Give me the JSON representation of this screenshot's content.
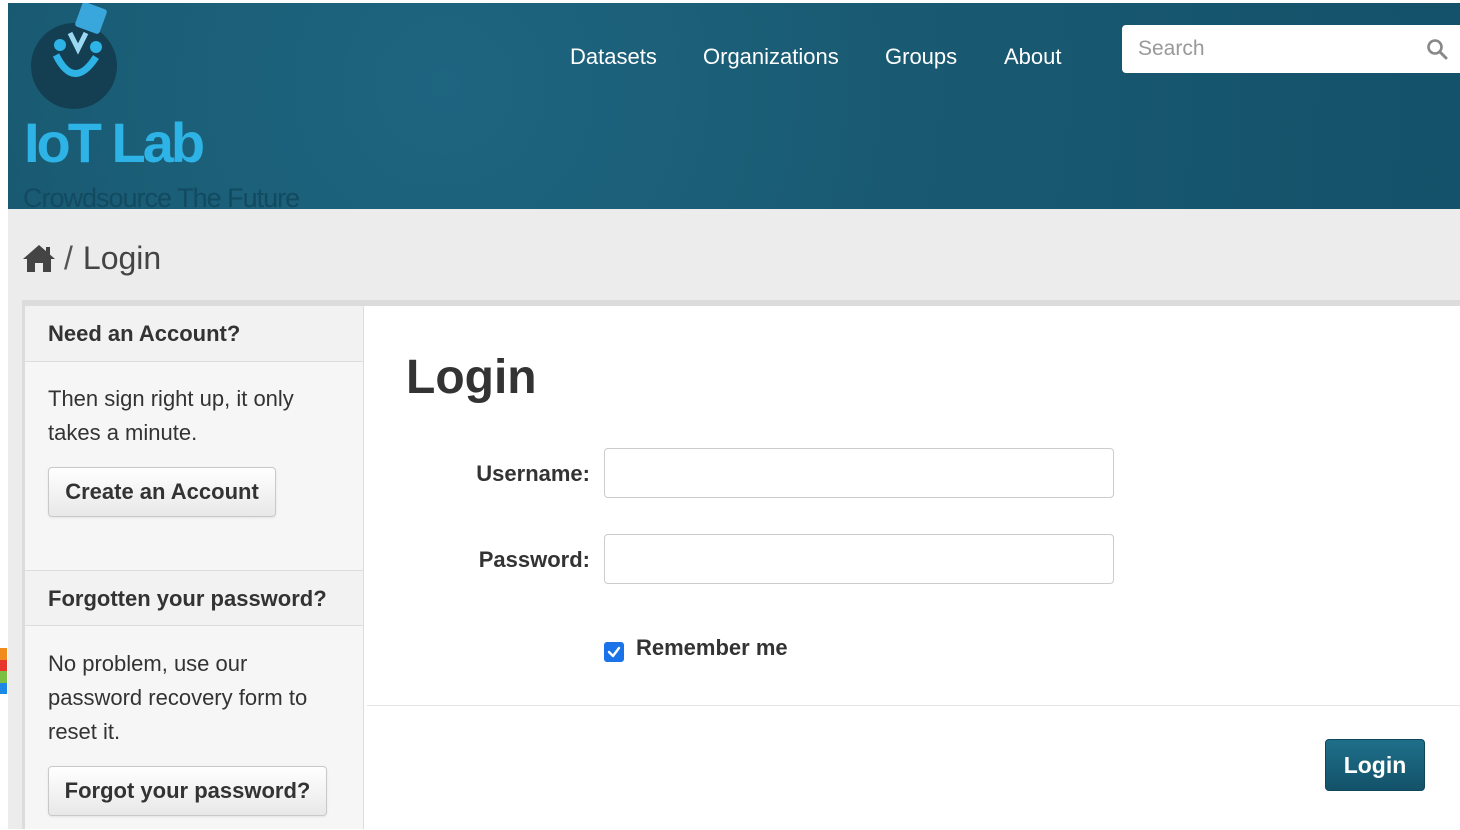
{
  "header": {
    "logo_title": "IoT Lab",
    "logo_tagline": "Crowdsource The Future",
    "nav": [
      {
        "label": "Datasets"
      },
      {
        "label": "Organizations"
      },
      {
        "label": "Groups"
      },
      {
        "label": "About"
      }
    ],
    "search": {
      "placeholder": "Search",
      "value": ""
    }
  },
  "breadcrumb": {
    "separator": "/",
    "current": "Login"
  },
  "sidebar": {
    "account": {
      "heading": "Need an Account?",
      "text": "Then sign right up, it only takes a minute.",
      "button": "Create an Account"
    },
    "forgot": {
      "heading": "Forgotten your password?",
      "text": "No problem, use our password recovery form to reset it.",
      "button": "Forgot your password?"
    }
  },
  "main": {
    "heading": "Login",
    "username_label": "Username:",
    "username_value": "",
    "password_label": "Password:",
    "password_value": "",
    "remember_label": "Remember me",
    "remember_checked": true,
    "submit_label": "Login"
  },
  "colors": {
    "header_bg": "#1a5c74",
    "brand_blue": "#2db3e6",
    "primary_button": "#1a6380",
    "checkbox": "#1a73e8"
  }
}
